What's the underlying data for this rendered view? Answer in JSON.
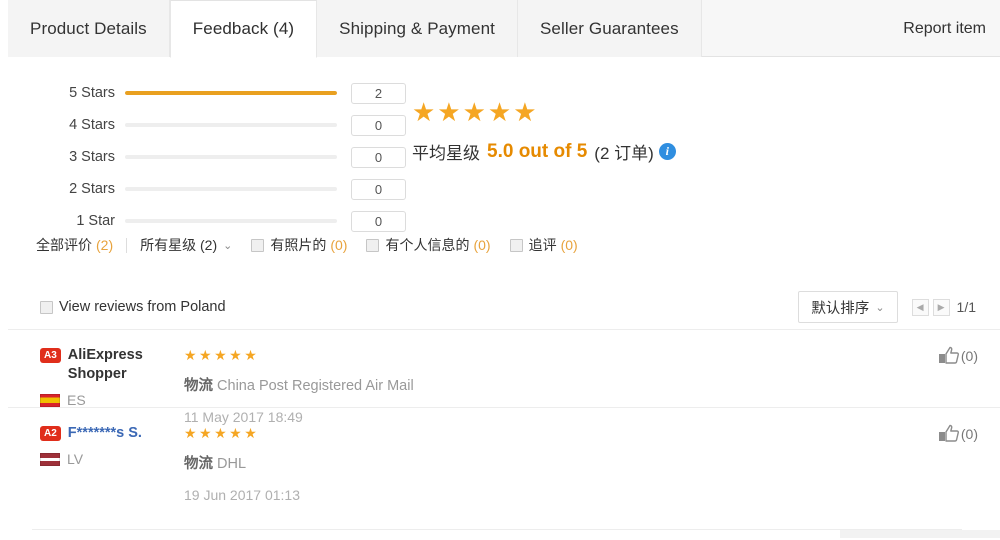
{
  "tabs": [
    {
      "label": "Product Details",
      "active": false
    },
    {
      "label": "Feedback (4)",
      "active": true
    },
    {
      "label": "Shipping & Payment",
      "active": false
    },
    {
      "label": "Seller Guarantees",
      "active": false
    }
  ],
  "report_item_label": "Report item",
  "rating_summary": {
    "bars": [
      {
        "label": "5 Stars",
        "count": "2",
        "percent": 100
      },
      {
        "label": "4 Stars",
        "count": "0",
        "percent": 0
      },
      {
        "label": "3 Stars",
        "count": "0",
        "percent": 0
      },
      {
        "label": "2 Stars",
        "count": "0",
        "percent": 0
      },
      {
        "label": "1 Star",
        "count": "0",
        "percent": 0
      }
    ],
    "stars_glyphs": "★★★★★",
    "average_label": "平均星级",
    "average_value": "5.0 out of 5",
    "orders_text": "(2 订单)",
    "info_glyph": "i",
    "bar_color": "#e9a020",
    "star_color": "#f5a623"
  },
  "filters": {
    "all_reviews": "全部评价",
    "all_reviews_count": "(2)",
    "all_stars": "所有星级 (2)",
    "caret_glyph": "⌄",
    "with_photos": "有照片的",
    "with_photos_count": "(0)",
    "with_personal_info": "有个人信息的",
    "with_personal_info_count": "(0)",
    "additional_reviews": "追评",
    "additional_reviews_count": "(0)"
  },
  "subbar": {
    "poland_label": "View reviews from Poland",
    "sort_label": "默认排序",
    "sort_caret": "⌄",
    "prev_glyph": "◀",
    "next_glyph": "▶",
    "page_text": "1/1"
  },
  "reviews": [
    {
      "level_badge": "A3",
      "name": "AliExpress Shopper",
      "name_is_link": false,
      "country_code": "ES",
      "flag_class": "flag-es",
      "stars": "★★★★★",
      "logistics_label": "物流",
      "logistics_value": "China Post Registered Air Mail",
      "date": "11 May 2017 18:49",
      "helpful_count": "(0)"
    },
    {
      "level_badge": "A2",
      "name": "F*******s S.",
      "name_is_link": true,
      "country_code": "LV",
      "flag_class": "flag-lv",
      "stars": "★★★★★",
      "logistics_label": "物流",
      "logistics_value": "DHL",
      "date": "19 Jun 2017 01:13",
      "helpful_count": "(0)"
    }
  ]
}
